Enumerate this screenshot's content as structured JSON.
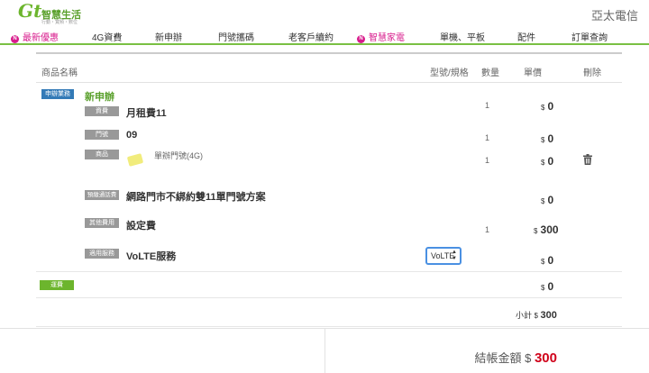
{
  "header": {
    "logo_mark": "Gt",
    "logo_brand": "智慧生活",
    "logo_tagline": "行動・寬頻・數位",
    "company": "亞太電信"
  },
  "nav": {
    "items": [
      {
        "label": "最新優惠",
        "hot": true
      },
      {
        "label": "4G資費",
        "hot": false
      },
      {
        "label": "新申辦",
        "hot": false
      },
      {
        "label": "門號攜碼",
        "hot": false
      },
      {
        "label": "老客戶續約",
        "hot": false
      },
      {
        "label": "智慧家電",
        "hot": true
      },
      {
        "label": "單機、平板",
        "hot": false
      },
      {
        "label": "配件",
        "hot": false
      },
      {
        "label": "訂單查詢",
        "hot": false
      }
    ],
    "hot_badge": "N"
  },
  "columns": {
    "product": "商品名稱",
    "model": "型號/規格",
    "qty": "數量",
    "unit_price": "單價",
    "delete": "刪除"
  },
  "section": {
    "badge": "申辦業務",
    "title": "新申辦"
  },
  "rows": {
    "plan": {
      "tag": "資費",
      "name": "月租費11",
      "qty": "1",
      "cur": "$",
      "price": "0"
    },
    "number": {
      "tag": "門號",
      "name": "09",
      "qty": "1",
      "cur": "$",
      "price": "0"
    },
    "product": {
      "tag": "商品",
      "name": "單辦門號(4G)",
      "qty": "1",
      "cur": "$",
      "price": "0"
    },
    "promo": {
      "tag": "預繳通話費",
      "name": "網路門市不綁約雙11單門號方案",
      "cur": "$",
      "price": "0"
    },
    "fee": {
      "tag": "其他費用",
      "name": "設定費",
      "qty": "1",
      "cur": "$",
      "price": "300"
    },
    "service": {
      "tag": "適用服務",
      "name": "VoLTE服務",
      "select_value": "VoLTE",
      "cur": "$",
      "price": "0"
    }
  },
  "shipping": {
    "badge": "運費",
    "cur": "$",
    "price": "0"
  },
  "subtotal": {
    "label": "小計",
    "cur": "$",
    "value": "300"
  },
  "total": {
    "label": "結帳金額",
    "cur": "$",
    "value": "300"
  },
  "icons": {
    "trash": "trash-icon",
    "sim": "sim-card-icon"
  },
  "colors": {
    "brand_green": "#6cb52d",
    "hot_pink": "#d81b8c",
    "badge_blue": "#337ab7",
    "total_red": "#d0021b"
  }
}
